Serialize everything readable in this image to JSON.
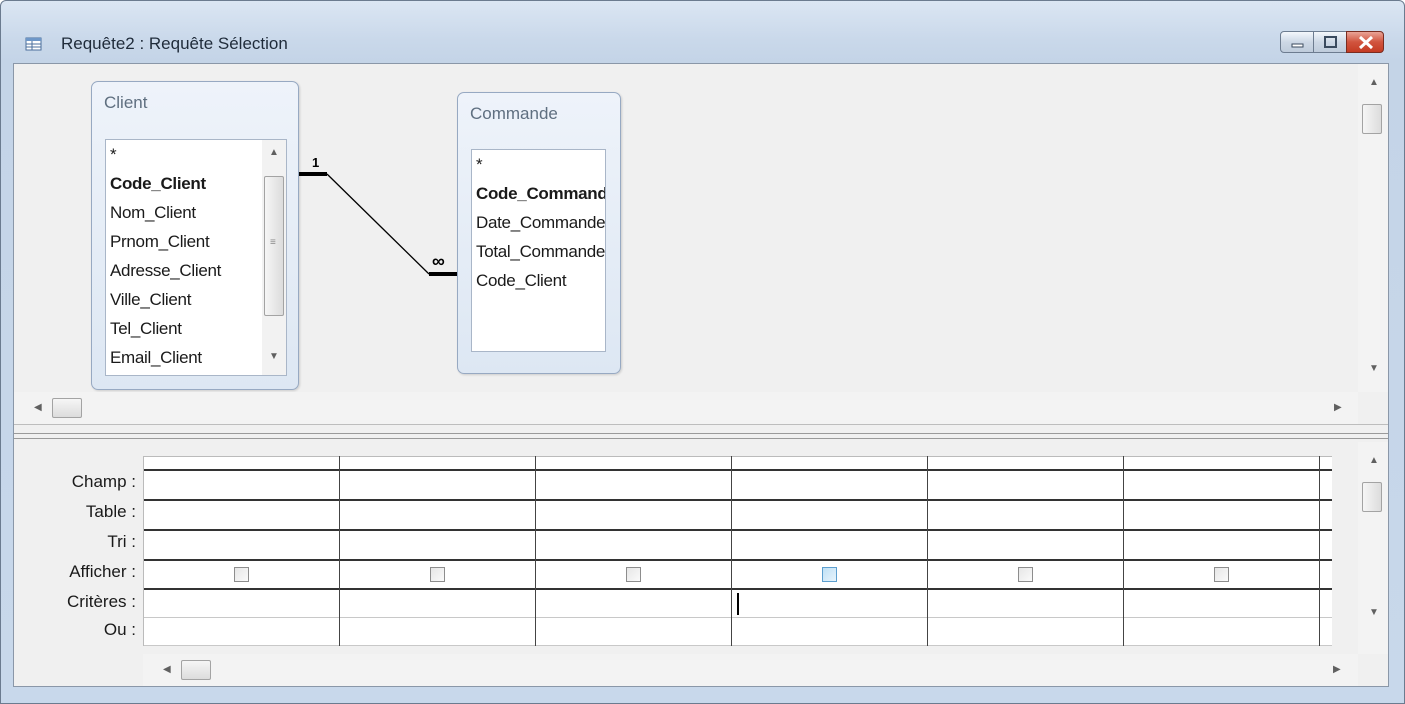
{
  "window": {
    "title": "Requête2 : Requête Sélection",
    "icons": [
      "query-icon",
      "minimize-icon",
      "maximize-icon",
      "close-icon"
    ]
  },
  "tables": [
    {
      "name": "Client",
      "fields": [
        "*",
        "Code_Client",
        "Nom_Client",
        "Prnom_Client",
        "Adresse_Client",
        "Ville_Client",
        "Tel_Client",
        "Email_Client"
      ],
      "key_field": "Code_Client"
    },
    {
      "name": "Commande",
      "fields": [
        "*",
        "Code_Commande",
        "Date_Commande",
        "Total_Commande",
        "Code_Client"
      ],
      "key_field": "Code_Commande"
    }
  ],
  "relation": {
    "one_label": "1",
    "many_label": "∞"
  },
  "grid": {
    "row_labels": [
      "Champ :",
      "Table :",
      "Tri :",
      "Afficher :",
      "Critères :",
      "Ou :"
    ],
    "column_count": 6,
    "show_checked": [
      false,
      false,
      false,
      false,
      false,
      false
    ],
    "active_column": 4
  },
  "colors": {
    "title_bar": "#c9d8ea",
    "close_button": "#c43b23",
    "active_checkbox": "#bfe0f5"
  }
}
